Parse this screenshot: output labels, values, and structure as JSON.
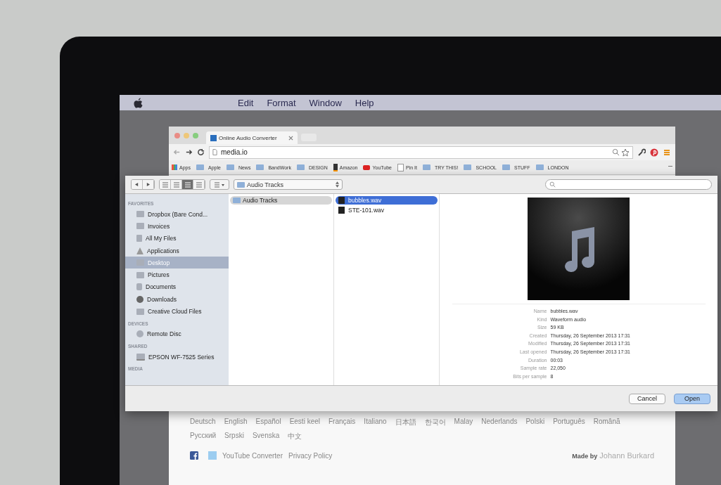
{
  "menu_bar": {
    "items": [
      "Edit",
      "Format",
      "Window",
      "Help"
    ]
  },
  "browser": {
    "tab_title": "Online Audio Converter",
    "address": "media.io",
    "bookmarks": [
      {
        "kind": "apps",
        "label": "Apps"
      },
      {
        "kind": "folder",
        "label": "Apple"
      },
      {
        "kind": "folder",
        "label": "News"
      },
      {
        "kind": "folder",
        "label": "BandWork"
      },
      {
        "kind": "folder",
        "label": "DESIGN"
      },
      {
        "kind": "amazon",
        "label": "Amazon"
      },
      {
        "kind": "youtube",
        "label": "YouTube"
      },
      {
        "kind": "page",
        "label": "Pin It"
      },
      {
        "kind": "folder",
        "label": "TRY THIS!"
      },
      {
        "kind": "folder",
        "label": "SCHOOL"
      },
      {
        "kind": "folder",
        "label": "STUFF"
      },
      {
        "kind": "folder",
        "label": "LONDON"
      }
    ],
    "languages": [
      "Deutsch",
      "English",
      "Español",
      "Eesti keel",
      "Français",
      "Italiano",
      "日本語",
      "한국어",
      "Malay",
      "Nederlands",
      "Polski",
      "Português",
      "Română",
      "Русский",
      "Srpski",
      "Svenska",
      "中文"
    ],
    "footer_links": [
      "YouTube Converter",
      "Privacy Policy"
    ],
    "credit": "**Made by** Johann Burkard"
  },
  "dialog": {
    "view_buttons": [
      {
        "selected": false
      },
      {
        "selected": false
      },
      {
        "selected": true
      },
      {
        "selected": false
      }
    ],
    "path": "Audio Tracks",
    "sidebar": [
      {
        "heading": "FAVORITES",
        "items": [
          {
            "kind": "folder",
            "label": "Dropbox (Bare Cond...",
            "selected": false
          },
          {
            "kind": "folder",
            "label": "Invoices",
            "selected": false
          },
          {
            "kind": "files",
            "label": "All My Files",
            "selected": false
          },
          {
            "kind": "apps",
            "label": "Applications",
            "selected": false
          },
          {
            "kind": "folder",
            "label": "Desktop",
            "selected": true
          },
          {
            "kind": "folder",
            "label": "Pictures",
            "selected": false
          },
          {
            "kind": "doc",
            "label": "Documents",
            "selected": false
          },
          {
            "kind": "download",
            "label": "Downloads",
            "selected": false
          },
          {
            "kind": "folder",
            "label": "Creative Cloud Files",
            "selected": false
          }
        ]
      },
      {
        "heading": "DEVICES",
        "items": [
          {
            "kind": "disc",
            "label": "Remote Disc",
            "selected": false
          }
        ]
      },
      {
        "heading": "SHARED",
        "items": [
          {
            "kind": "display",
            "label": "EPSON WF-7525 Series",
            "selected": false
          }
        ]
      },
      {
        "heading": "MEDIA"
      }
    ],
    "column_1": [
      {
        "label": "Audio Tracks",
        "selected": true
      }
    ],
    "column_2": [
      {
        "label": "bubbles.wav",
        "selected": true
      },
      {
        "label": "STE-101.wav",
        "selected": false
      }
    ],
    "info": [
      {
        "label": "Name",
        "value": "bubbles.wav"
      },
      {
        "label": "Kind",
        "value": "Waveform audio"
      },
      {
        "label": "Size",
        "value": "59 KB"
      },
      {
        "label": "Created",
        "value": "Thursday, 26 September 2013 17:31"
      },
      {
        "label": "Modified",
        "value": "Thursday, 26 September 2013 17:31"
      },
      {
        "label": "Last opened",
        "value": "Thursday, 26 September 2013 17:31"
      },
      {
        "label": "Duration",
        "value": "00:03"
      },
      {
        "label": "Sample rate",
        "value": "22,050"
      },
      {
        "label": "Bits per sample",
        "value": "8"
      }
    ],
    "buttons": [
      {
        "label": "Cancel",
        "default": false
      },
      {
        "label": "Open",
        "default": true
      }
    ]
  }
}
